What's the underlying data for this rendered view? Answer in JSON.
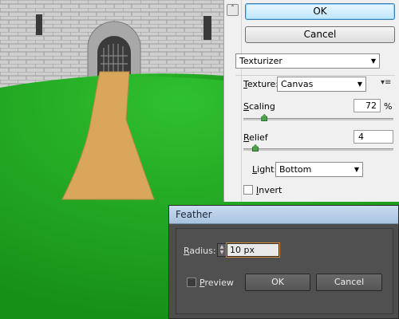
{
  "texturizer_panel": {
    "ok_label": "OK",
    "cancel_label": "Cancel",
    "filter_name": "Texturizer",
    "texture_label": "Texture:",
    "texture_value": "Canvas",
    "scaling_label": "Scaling",
    "scaling_value": "72",
    "scaling_unit": "%",
    "scaling_fraction": 0.14,
    "relief_label": "Relief",
    "relief_value": "4",
    "relief_fraction": 0.08,
    "light_label": "Light:",
    "light_value": "Bottom",
    "invert_label": "Invert",
    "invert_checked": false
  },
  "feather_dialog": {
    "title": "Feather",
    "radius_label": "Radius:",
    "radius_value": "10 px",
    "preview_label": "Preview",
    "preview_checked": false,
    "ok_label": "OK",
    "cancel_label": "Cancel"
  },
  "colors": {
    "grass": "#1fa51f",
    "path": "#d9a75b",
    "stone": "#cfcfcf",
    "dialog_bg": "#4d4d4d",
    "ok_focus": "#3c7fb1"
  }
}
